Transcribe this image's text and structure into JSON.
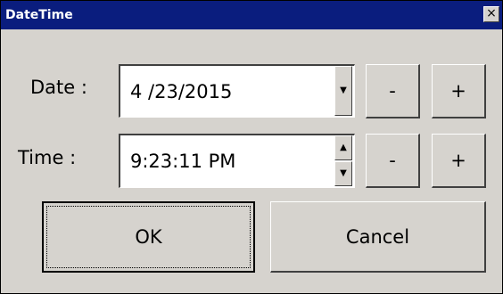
{
  "window": {
    "title": "DateTime",
    "close_glyph": "×"
  },
  "date": {
    "label": "Date :",
    "value": "4 /23/2015",
    "dropdown_glyph": "▼",
    "decrement_label": "-",
    "increment_label": "+"
  },
  "time": {
    "label": "Time :",
    "value": "9:23:11 PM",
    "spin_up_glyph": "▲",
    "spin_down_glyph": "▼",
    "decrement_label": "-",
    "increment_label": "+"
  },
  "actions": {
    "ok_label": "OK",
    "cancel_label": "Cancel"
  },
  "colors": {
    "titlebar": "#0a1d7e",
    "dialog_face": "#d6d3ce",
    "field_background": "#ffffff"
  }
}
